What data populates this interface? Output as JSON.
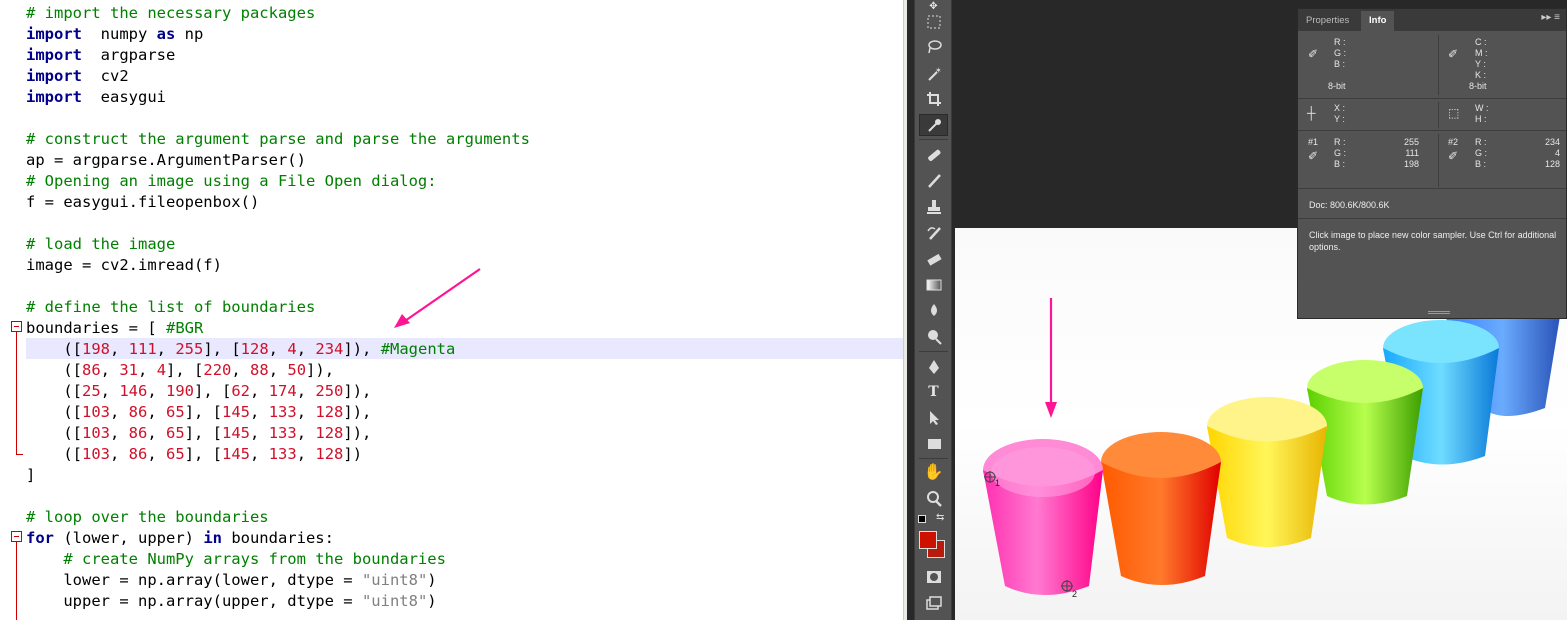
{
  "editor": {
    "lines": [
      [
        [
          "cm",
          "# import the necessary packages"
        ]
      ],
      [
        [
          "kw",
          "import"
        ],
        [
          "",
          "  numpy "
        ],
        [
          "kw",
          "as"
        ],
        [
          "",
          " np"
        ]
      ],
      [
        [
          "kw",
          "import"
        ],
        [
          "",
          "  argparse"
        ]
      ],
      [
        [
          "kw",
          "import"
        ],
        [
          "",
          "  cv2"
        ]
      ],
      [
        [
          "kw",
          "import"
        ],
        [
          "",
          "  easygui"
        ]
      ],
      [],
      [
        [
          "cm",
          "# construct the argument parse and parse the arguments"
        ]
      ],
      [
        [
          "",
          "ap = argparse.ArgumentParser()"
        ]
      ],
      [
        [
          "cm",
          "# Opening an image using a File Open dialog:"
        ]
      ],
      [
        [
          "",
          "f = easygui.fileopenbox()"
        ]
      ],
      [],
      [
        [
          "cm",
          "# load the image"
        ]
      ],
      [
        [
          "",
          "image = cv2.imread(f)"
        ]
      ],
      [],
      [
        [
          "cm",
          "# define the list of boundaries"
        ]
      ],
      [
        [
          "",
          "boundaries = [ "
        ],
        [
          "cm",
          "#BGR"
        ]
      ],
      [
        [
          "",
          "    (["
        ],
        [
          "num",
          "198"
        ],
        [
          "",
          ", "
        ],
        [
          "num",
          "111"
        ],
        [
          "",
          ", "
        ],
        [
          "num",
          "255"
        ],
        [
          "",
          "], ["
        ],
        [
          "num",
          "128"
        ],
        [
          "",
          ", "
        ],
        [
          "num",
          "4"
        ],
        [
          "",
          ", "
        ],
        [
          "num",
          "234"
        ],
        [
          "",
          "]), "
        ],
        [
          "cm",
          "#Magenta"
        ]
      ],
      [
        [
          "",
          "    (["
        ],
        [
          "num",
          "86"
        ],
        [
          "",
          ", "
        ],
        [
          "num",
          "31"
        ],
        [
          "",
          ", "
        ],
        [
          "num",
          "4"
        ],
        [
          "",
          "], ["
        ],
        [
          "num",
          "220"
        ],
        [
          "",
          ", "
        ],
        [
          "num",
          "88"
        ],
        [
          "",
          ", "
        ],
        [
          "num",
          "50"
        ],
        [
          "",
          "]),"
        ]
      ],
      [
        [
          "",
          "    (["
        ],
        [
          "num",
          "25"
        ],
        [
          "",
          ", "
        ],
        [
          "num",
          "146"
        ],
        [
          "",
          ", "
        ],
        [
          "num",
          "190"
        ],
        [
          "",
          "], ["
        ],
        [
          "num",
          "62"
        ],
        [
          "",
          ", "
        ],
        [
          "num",
          "174"
        ],
        [
          "",
          ", "
        ],
        [
          "num",
          "250"
        ],
        [
          "",
          "]),"
        ]
      ],
      [
        [
          "",
          "    (["
        ],
        [
          "num",
          "103"
        ],
        [
          "",
          ", "
        ],
        [
          "num",
          "86"
        ],
        [
          "",
          ", "
        ],
        [
          "num",
          "65"
        ],
        [
          "",
          "], ["
        ],
        [
          "num",
          "145"
        ],
        [
          "",
          ", "
        ],
        [
          "num",
          "133"
        ],
        [
          "",
          ", "
        ],
        [
          "num",
          "128"
        ],
        [
          "",
          "]),"
        ]
      ],
      [
        [
          "",
          "    (["
        ],
        [
          "num",
          "103"
        ],
        [
          "",
          ", "
        ],
        [
          "num",
          "86"
        ],
        [
          "",
          ", "
        ],
        [
          "num",
          "65"
        ],
        [
          "",
          "], ["
        ],
        [
          "num",
          "145"
        ],
        [
          "",
          ", "
        ],
        [
          "num",
          "133"
        ],
        [
          "",
          ", "
        ],
        [
          "num",
          "128"
        ],
        [
          "",
          "]),"
        ]
      ],
      [
        [
          "",
          "    (["
        ],
        [
          "num",
          "103"
        ],
        [
          "",
          ", "
        ],
        [
          "num",
          "86"
        ],
        [
          "",
          ", "
        ],
        [
          "num",
          "65"
        ],
        [
          "",
          "], ["
        ],
        [
          "num",
          "145"
        ],
        [
          "",
          ", "
        ],
        [
          "num",
          "133"
        ],
        [
          "",
          ", "
        ],
        [
          "num",
          "128"
        ],
        [
          "",
          "])"
        ]
      ],
      [
        [
          "",
          "]"
        ]
      ],
      [],
      [
        [
          "cm",
          "# loop over the boundaries"
        ]
      ],
      [
        [
          "kw",
          "for"
        ],
        [
          "",
          " (lower, upper) "
        ],
        [
          "kw",
          "in"
        ],
        [
          "",
          " boundaries:"
        ]
      ],
      [
        [
          "",
          "    "
        ],
        [
          "cm",
          "# create NumPy arrays from the boundaries"
        ]
      ],
      [
        [
          "",
          "    lower = np.array(lower, dtype = "
        ],
        [
          "str",
          "\"uint8\""
        ],
        [
          "",
          ")"
        ]
      ],
      [
        [
          "",
          "    upper = np.array(upper, dtype = "
        ],
        [
          "str",
          "\"uint8\""
        ],
        [
          "",
          ")"
        ]
      ]
    ]
  },
  "panel": {
    "tabs": [
      "Properties",
      "Info"
    ],
    "active_tab": "Info",
    "rgb_labels": [
      "R :",
      "G :",
      "B :"
    ],
    "cmyk_labels": [
      "C :",
      "M :",
      "Y :",
      "K :"
    ],
    "bitdepth_left": "8-bit",
    "bitdepth_right": "8-bit",
    "xy_labels": [
      "X :",
      "Y :"
    ],
    "wh_labels": [
      "W :",
      "H :"
    ],
    "sampler1": {
      "id": "#1",
      "labels": [
        "R :",
        "G :",
        "B :"
      ],
      "values": [
        "255",
        "111",
        "198"
      ]
    },
    "sampler2": {
      "id": "#2",
      "labels": [
        "R :",
        "G :",
        "B :"
      ],
      "values": [
        "234",
        "4",
        "128"
      ]
    },
    "doc": "Doc: 800.6K/800.6K",
    "hint": "Click image to place new color sampler.  Use Ctrl for additional options."
  },
  "canvas": {
    "sampler_labels": [
      "1",
      "2"
    ]
  },
  "colors": {
    "arrow": "#ff1493",
    "foreground": "#cc1100",
    "background": "#b81a0c"
  }
}
